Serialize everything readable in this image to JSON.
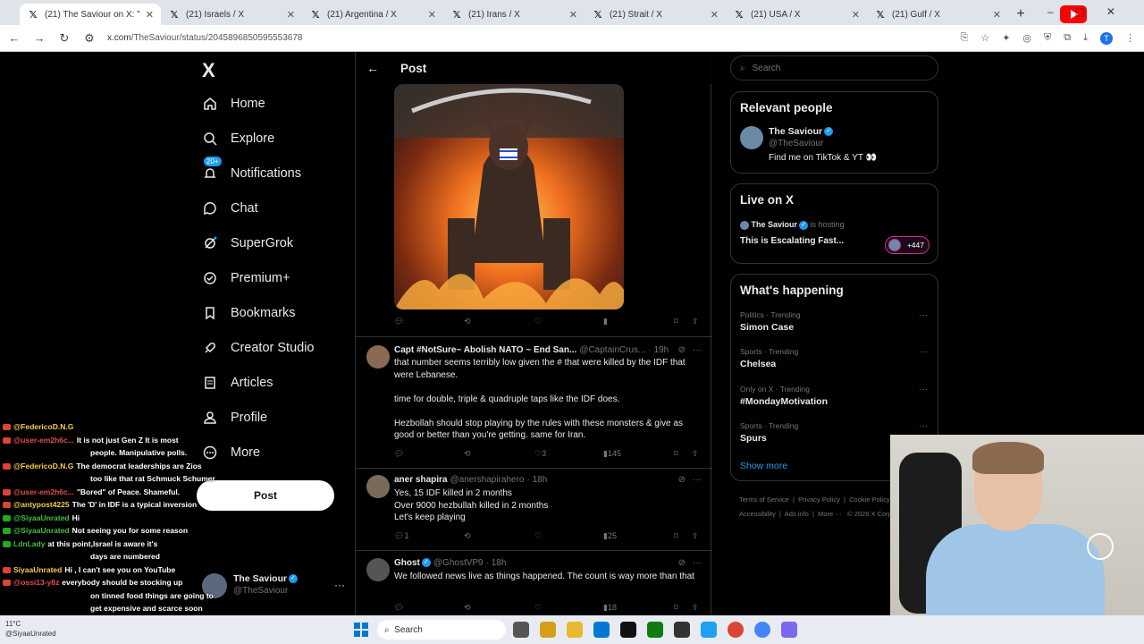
{
  "browser": {
    "tabs": [
      {
        "title": "(21) The Saviour on X: \"",
        "active": true
      },
      {
        "title": "(21) Israels / X",
        "active": false
      },
      {
        "title": "(21) Argentina / X",
        "active": false
      },
      {
        "title": "(21) Irans / X",
        "active": false
      },
      {
        "title": "(21) Strait / X",
        "active": false
      },
      {
        "title": "(21) USA / X",
        "active": false
      },
      {
        "title": "(21) Gulf / X",
        "active": false
      }
    ],
    "url_site": "x.com",
    "url_path": "/TheSaviour/status/2045896850595553678"
  },
  "nav": {
    "brand": "X",
    "items": [
      {
        "label": "Home",
        "icon": "home-icon"
      },
      {
        "label": "Explore",
        "icon": "search-icon"
      },
      {
        "label": "Notifications",
        "icon": "bell-icon",
        "badge": "20+"
      },
      {
        "label": "Chat",
        "icon": "chat-icon"
      },
      {
        "label": "SuperGrok",
        "icon": "grok-icon"
      },
      {
        "label": "Premium+",
        "icon": "premium-icon"
      },
      {
        "label": "Bookmarks",
        "icon": "bookmark-icon"
      },
      {
        "label": "Creator Studio",
        "icon": "rocket-icon"
      },
      {
        "label": "Articles",
        "icon": "article-icon"
      },
      {
        "label": "Profile",
        "icon": "person-icon"
      },
      {
        "label": "More",
        "icon": "more-circle-icon"
      }
    ],
    "post_button": "Post",
    "account": {
      "name": "The Saviour",
      "handle": "@TheSaviour"
    }
  },
  "center": {
    "header_title": "Post",
    "main_post": {
      "image_flag": "🇮🇱"
    },
    "replies": [
      {
        "name": "Capt #NotSure~ Abolish NATO ~ End San...",
        "handle": "@CaptainCrus...",
        "time": "· 19h",
        "body": [
          "that number seems terribly low given the # that were killed by the IDF that were Lebanese.",
          "",
          "time for double, triple & quadruple taps like the IDF does.",
          "",
          "Hezbollah should stop playing by the rules with these monsters & give as good or better than you're getting. same for Iran."
        ],
        "replies": "",
        "reposts": "",
        "likes": "3",
        "views": "145"
      },
      {
        "name": "aner shapira",
        "handle": "@anershapirahero",
        "time": "· 18h",
        "body": [
          "Yes, 15 IDF killed in 2 months",
          "Over 9000 hezbullah killed in 2 months",
          "Let's keep playing"
        ],
        "replies": "1",
        "reposts": "",
        "likes": "",
        "views": "25"
      },
      {
        "name": "Ghost",
        "handle": "@GhostVP9",
        "time": "· 18h",
        "verified": true,
        "body": [
          "We followed news live as things happened. The  count is way more than that"
        ],
        "replies": "",
        "reposts": "",
        "likes": "",
        "views": "18"
      }
    ]
  },
  "right": {
    "search_placeholder": "Search",
    "relevant": {
      "title": "Relevant people",
      "name": "The Saviour",
      "handle": "@TheSaviour",
      "bio": "Find me on TikTok & YT 👀"
    },
    "live": {
      "title": "Live on X",
      "host": "The Saviour",
      "status": "is hosting",
      "space_title": "This is Escalating Fast...",
      "listeners": "+447"
    },
    "happening": {
      "title": "What's happening",
      "trends": [
        {
          "category": "Politics · Trending",
          "title": "Simon Case"
        },
        {
          "category": "Sports · Trending",
          "title": "Chelsea"
        },
        {
          "category": "Only on X · Trending",
          "title": "#MondayMotivation"
        },
        {
          "category": "Sports · Trending",
          "title": "Spurs"
        }
      ],
      "show_more": "Show more"
    },
    "footer": [
      "Terms of Service",
      "|",
      "Privacy Policy",
      "|",
      "Cookie Policy",
      "|",
      "Accessibility",
      "|",
      "Ads info",
      "|",
      "More ···",
      "© 2026 X Corp."
    ]
  },
  "chat": [
    {
      "user": "@FedericoD.N.G",
      "msg": "",
      "color": "#f0d040"
    },
    {
      "user": "@user-em2h6c...",
      "msg": "It is not just Gen Z It is most",
      "color": "#e0504a"
    },
    {
      "user": "",
      "msg": "people. Manipulative polls.",
      "color": "#fff"
    },
    {
      "user": "@FedericoD.N.G",
      "msg": "The democrat leaderships are Zios",
      "color": "#f0d040"
    },
    {
      "user": "",
      "msg": "too like that rat Schmuck Schumer",
      "color": "#fff"
    },
    {
      "user": "@user-em2h6c...",
      "msg": "\"Bored\" of Peace. Shameful.",
      "color": "#e0504a"
    },
    {
      "user": "@antypost4225",
      "msg": "The 'D' in IDF is a typical inversion",
      "color": "#f0d040"
    },
    {
      "user": "@SiyaaUnrated",
      "msg": "Hi",
      "color": "#40c040"
    },
    {
      "user": "@SiyaaUnrated",
      "msg": "Not seeing you for some reason",
      "color": "#40c040"
    },
    {
      "user": "LdnLady",
      "msg": "at this point,Israel is aware it's",
      "color": "#40c040"
    },
    {
      "user": "",
      "msg": "days are numbered",
      "color": "#fff"
    },
    {
      "user": "SiyaaUnrated",
      "msg": "Hi , I can't see you on YouTube",
      "color": "#f0d040"
    },
    {
      "user": "@ossi13-y8z",
      "msg": "everybody should be stocking up",
      "color": "#e0504a"
    },
    {
      "user": "",
      "msg": "on tinned food things are going to",
      "color": "#fff"
    },
    {
      "user": "",
      "msg": "get expensive and scarce soon",
      "color": "#fff"
    }
  ],
  "taskbar": {
    "weather_temp": "11°C",
    "weather_label": "@SiyaaUnrated",
    "search": "Search"
  },
  "colors": {
    "accent": "#1d9bf0",
    "bg": "#000000",
    "text": "#e7e9ea",
    "muted": "#71767b"
  }
}
